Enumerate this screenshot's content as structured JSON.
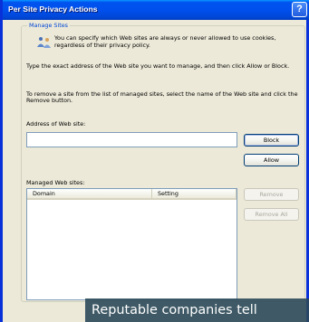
{
  "window": {
    "title": "Per Site Privacy Actions",
    "help_glyph": "?",
    "close_glyph": "X"
  },
  "manage_sites": {
    "group_label": "Manage Sites",
    "intro_icon": "privacy-people-icon",
    "intro": "You can specify which Web sites are always or never allowed to use cookies, regardless of their privacy policy.",
    "instructions_add": "Type the exact address of the Web site you want to manage, and then click Allow or Block.",
    "instructions_remove": "To remove a site from the list of managed sites, select the name of the Web site and click the Remove button.",
    "address_label": "Address of Web site:",
    "address_value": "",
    "block_label": "Block",
    "allow_label": "Allow",
    "managed_label": "Managed Web sites:",
    "columns": [
      "Domain",
      "Setting"
    ],
    "rows": [],
    "remove_label": "Remove",
    "remove_all_label": "Remove All"
  },
  "caption": "Reputable companies tell",
  "colors": {
    "titlebar": "#0053ee",
    "dialog_bg": "#ece9d8",
    "group_label": "#0046d5",
    "caption_bg": "#2c4a5a"
  }
}
